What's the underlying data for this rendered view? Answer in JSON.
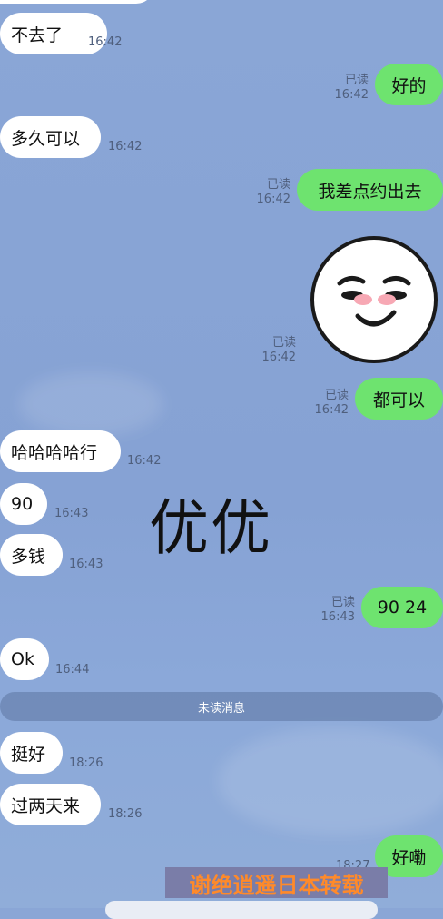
{
  "messages": [
    {
      "side": "in",
      "text": "不去了",
      "time": "16:42"
    },
    {
      "side": "out",
      "text": "好的",
      "read": "已读",
      "time": "16:42"
    },
    {
      "side": "in",
      "text": "多久可以",
      "time": "16:42"
    },
    {
      "side": "out",
      "text": "我差点约出去",
      "read": "已读",
      "time": "16:42"
    },
    {
      "side": "out",
      "text": "都可以",
      "read": "已读",
      "time": "16:42"
    },
    {
      "side": "in",
      "text": "哈哈哈哈行",
      "time": "16:42"
    },
    {
      "side": "in",
      "text": "90",
      "time": "16:43"
    },
    {
      "side": "in",
      "text": "多钱",
      "time": "16:43"
    },
    {
      "side": "out",
      "text": "90 24",
      "read": "已读",
      "time": "16:43"
    },
    {
      "side": "in",
      "text": "Ok",
      "time": "16:44"
    },
    {
      "side": "in",
      "text": "挺好",
      "time": "18:26"
    },
    {
      "side": "in",
      "text": "过两天来",
      "time": "18:26"
    },
    {
      "side": "out",
      "text": "好嘞",
      "time": "18:27"
    }
  ],
  "sticker": {
    "read": "已读",
    "time": "16:42",
    "icon": "smiling-moon-sticker-icon"
  },
  "divider_label": "未读消息",
  "watermark_center": "优优",
  "watermark_bottom": "谢绝逍遥日本转载",
  "colors": {
    "background": "#8aa6d6",
    "incoming_bubble": "#ffffff",
    "outgoing_bubble": "#6ee36f",
    "watermark": "#ff8a2a"
  }
}
